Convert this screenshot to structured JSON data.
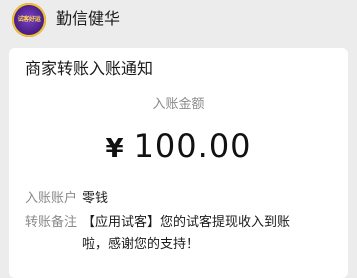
{
  "header": {
    "avatar_text": "试客好运",
    "account_name": "勤信健华"
  },
  "card": {
    "title": "商家转账入账通知",
    "amount_label": "入账金额",
    "currency_symbol": "¥",
    "amount": "100.00",
    "fields": [
      {
        "key": "入账账户",
        "value": "零钱"
      },
      {
        "key": "转账备注",
        "value": "【应用试客】您的试客提现收入到账啦，感谢您的支持！"
      }
    ]
  },
  "colors": {
    "page_background": "#ececec",
    "card_background": "#ffffff",
    "label_gray": "#8a8a8a",
    "avatar_purple": "#4a1f86",
    "avatar_gold": "#f2c230"
  }
}
